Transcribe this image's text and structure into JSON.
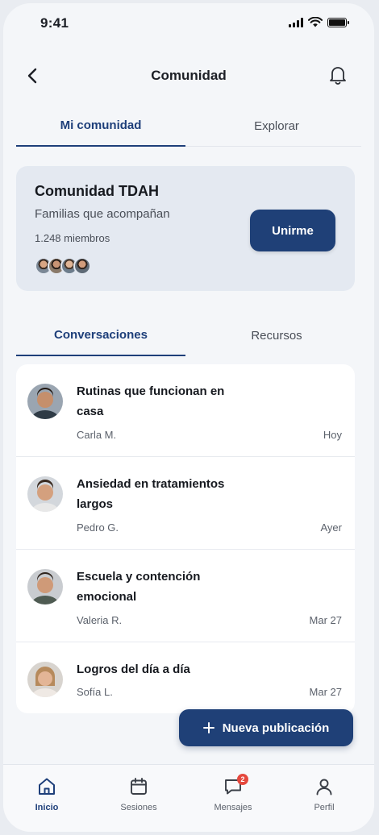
{
  "status_bar": {
    "time": "9:41"
  },
  "header": {
    "title": "Comunidad"
  },
  "top_tabs": [
    {
      "label": "Mi comunidad"
    },
    {
      "label": "Explorar"
    }
  ],
  "community": {
    "name": "Comunidad TDAH",
    "subtitle": "Familias que acompañan",
    "members": "1.248 miembros",
    "join_label": "Unirme"
  },
  "sub_tabs": [
    {
      "label": "Conversaciones"
    },
    {
      "label": "Recursos"
    }
  ],
  "conversations": [
    {
      "title": "Rutinas que funcionan en casa",
      "author": "Carla M.",
      "date": "Hoy"
    },
    {
      "title": "Ansiedad en tratamientos largos",
      "author": "Pedro G.",
      "date": "Ayer"
    },
    {
      "title": "Escuela y contención emocional",
      "author": "Valeria R.",
      "date": "Mar 27"
    },
    {
      "title": "Logros del día a día",
      "author": "Sofía L.",
      "date": "Mar 27"
    }
  ],
  "fab": {
    "label": "Nueva publicación"
  },
  "bottom_nav": [
    {
      "label": "Inicio",
      "icon": "home-icon"
    },
    {
      "label": "Sesiones",
      "icon": "calendar-icon"
    },
    {
      "label": "Mensajes",
      "icon": "chat-icon",
      "badge": "2"
    },
    {
      "label": "Perfil",
      "icon": "user-icon"
    }
  ],
  "colors": {
    "primary": "#1f4077",
    "badge": "#e5483d"
  }
}
